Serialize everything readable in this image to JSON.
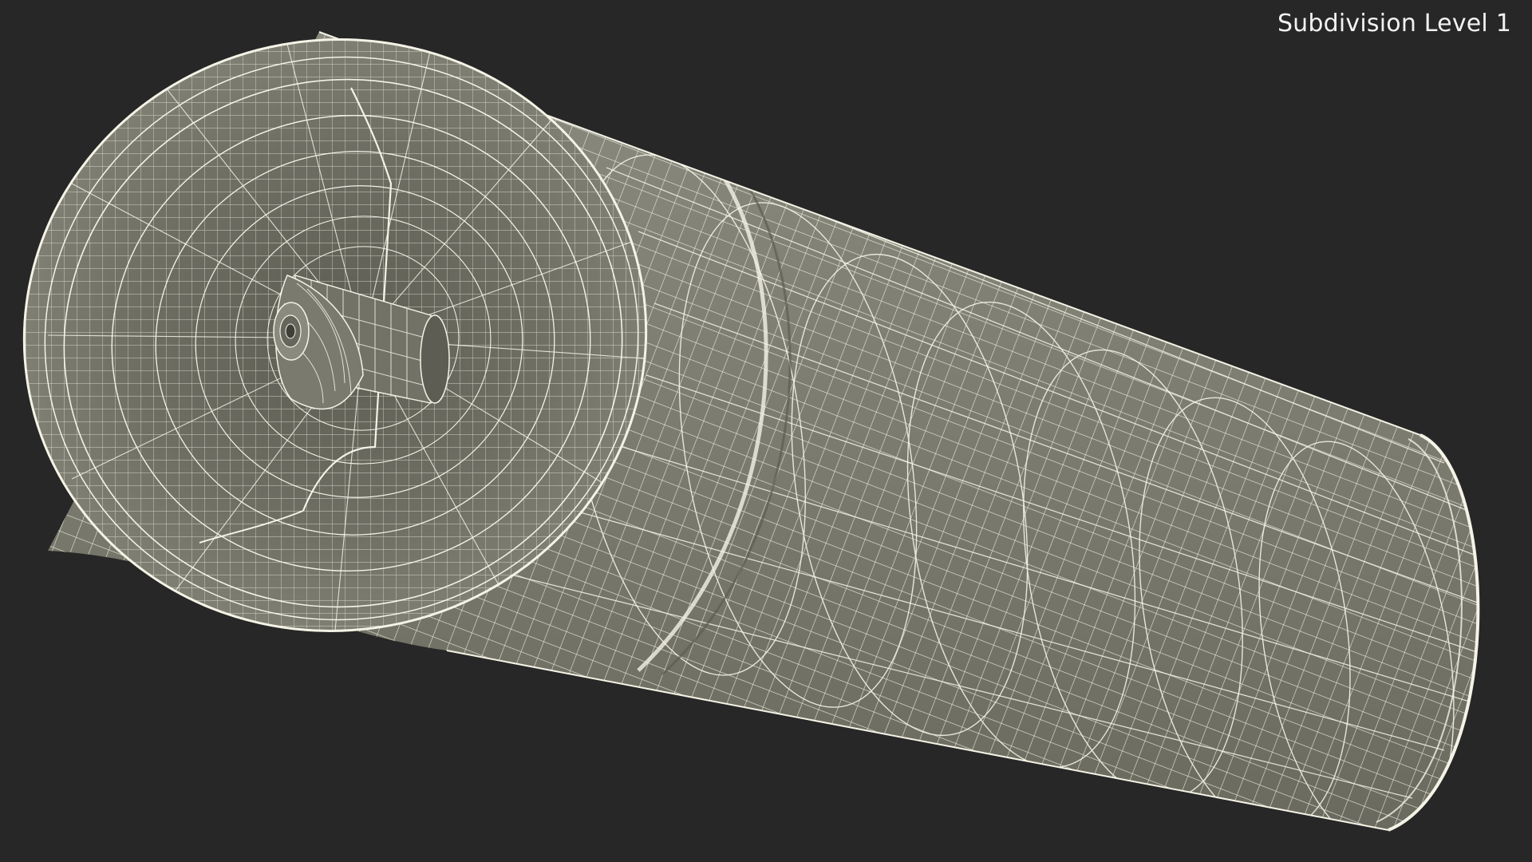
{
  "viewport": {
    "background": "#272727",
    "label": "Subdivision Level 1"
  },
  "model": {
    "surface_color": "#7c7c70",
    "wire_color": "#f4f3e6",
    "shadow_color": "#5f5f55"
  }
}
